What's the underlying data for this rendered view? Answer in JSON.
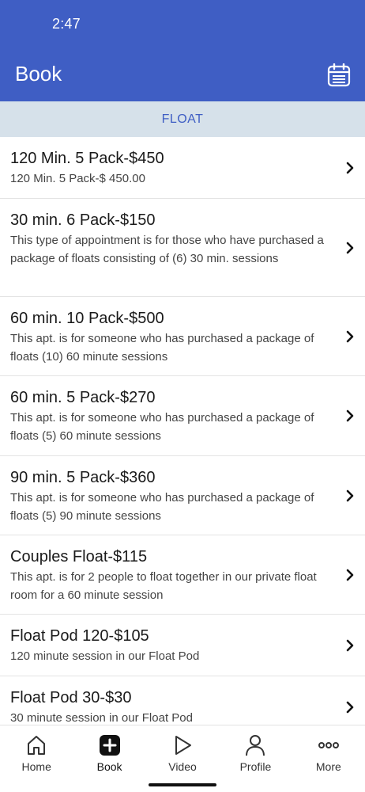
{
  "status": {
    "time": "2:47"
  },
  "header": {
    "title": "Book",
    "calendar_icon": "calendar-icon",
    "background": "#3f5ec4"
  },
  "section": {
    "label": "FLOAT"
  },
  "items": [
    {
      "title": "120 Min. 5 Pack-$450",
      "description": "120 Min. 5 Pack-$ 450.00"
    },
    {
      "title": "30 min. 6 Pack-$150",
      "description": "This type of appointment is for those who have purchased a package of floats consisting of (6) 30 min. sessions"
    },
    {
      "title": "60 min. 10 Pack-$500",
      "description": "This apt. is for someone who has purchased a package of floats (10) 60 minute sessions"
    },
    {
      "title": "60 min. 5 Pack-$270",
      "description": "This apt. is for someone who has purchased a package of floats (5) 60 minute sessions"
    },
    {
      "title": "90 min. 5 Pack-$360",
      "description": "This apt. is for someone who has purchased a package of floats (5) 90 minute sessions"
    },
    {
      "title": "Couples Float-$115",
      "description": "This apt. is for 2 people to float together in our private float room for a 60 minute session"
    },
    {
      "title": "Float Pod 120-$105",
      "description": "120 minute session in our Float Pod"
    },
    {
      "title": "Float Pod 30-$30",
      "description": "30 minute session in our Float Pod"
    }
  ],
  "tabs": [
    {
      "label": "Home",
      "icon": "home-icon"
    },
    {
      "label": "Book",
      "icon": "plus-square-icon"
    },
    {
      "label": "Video",
      "icon": "play-icon"
    },
    {
      "label": "Profile",
      "icon": "user-icon"
    },
    {
      "label": "More",
      "icon": "more-icon"
    }
  ]
}
